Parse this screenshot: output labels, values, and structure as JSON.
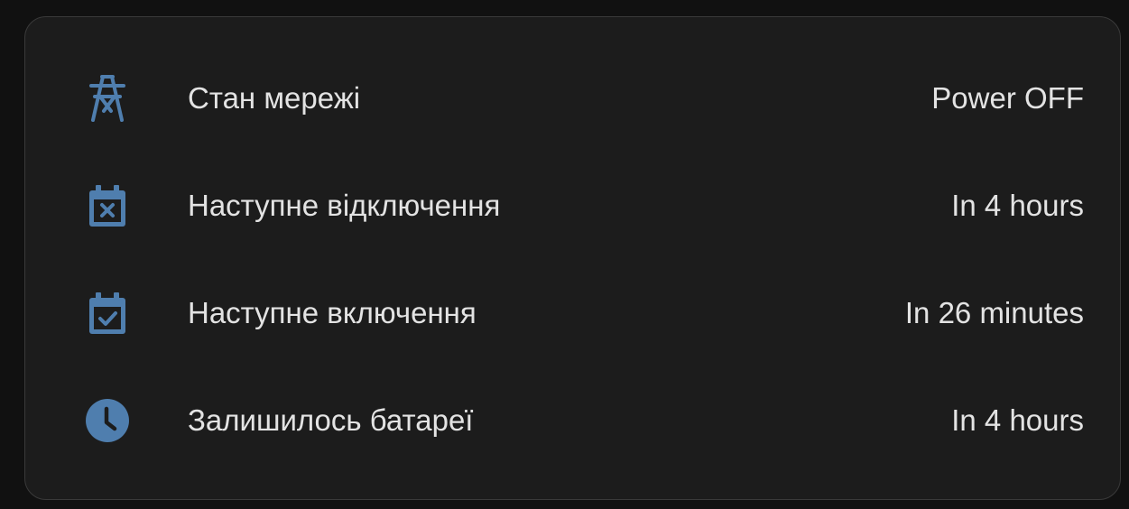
{
  "colors": {
    "icon": "#4f7eae",
    "text": "#e3e3e3",
    "card_background": "#1c1c1c",
    "page_background": "#111111"
  },
  "entities": [
    {
      "icon": "transmission-tower-icon",
      "label": "Стан мережі",
      "value": "Power OFF"
    },
    {
      "icon": "calendar-remove-icon",
      "label": "Наступне відключення",
      "value": "In 4 hours"
    },
    {
      "icon": "calendar-check-icon",
      "label": "Наступне включення",
      "value": "In 26 minutes"
    },
    {
      "icon": "clock-icon",
      "label": "Залишилось батареї",
      "value": "In 4 hours"
    }
  ]
}
